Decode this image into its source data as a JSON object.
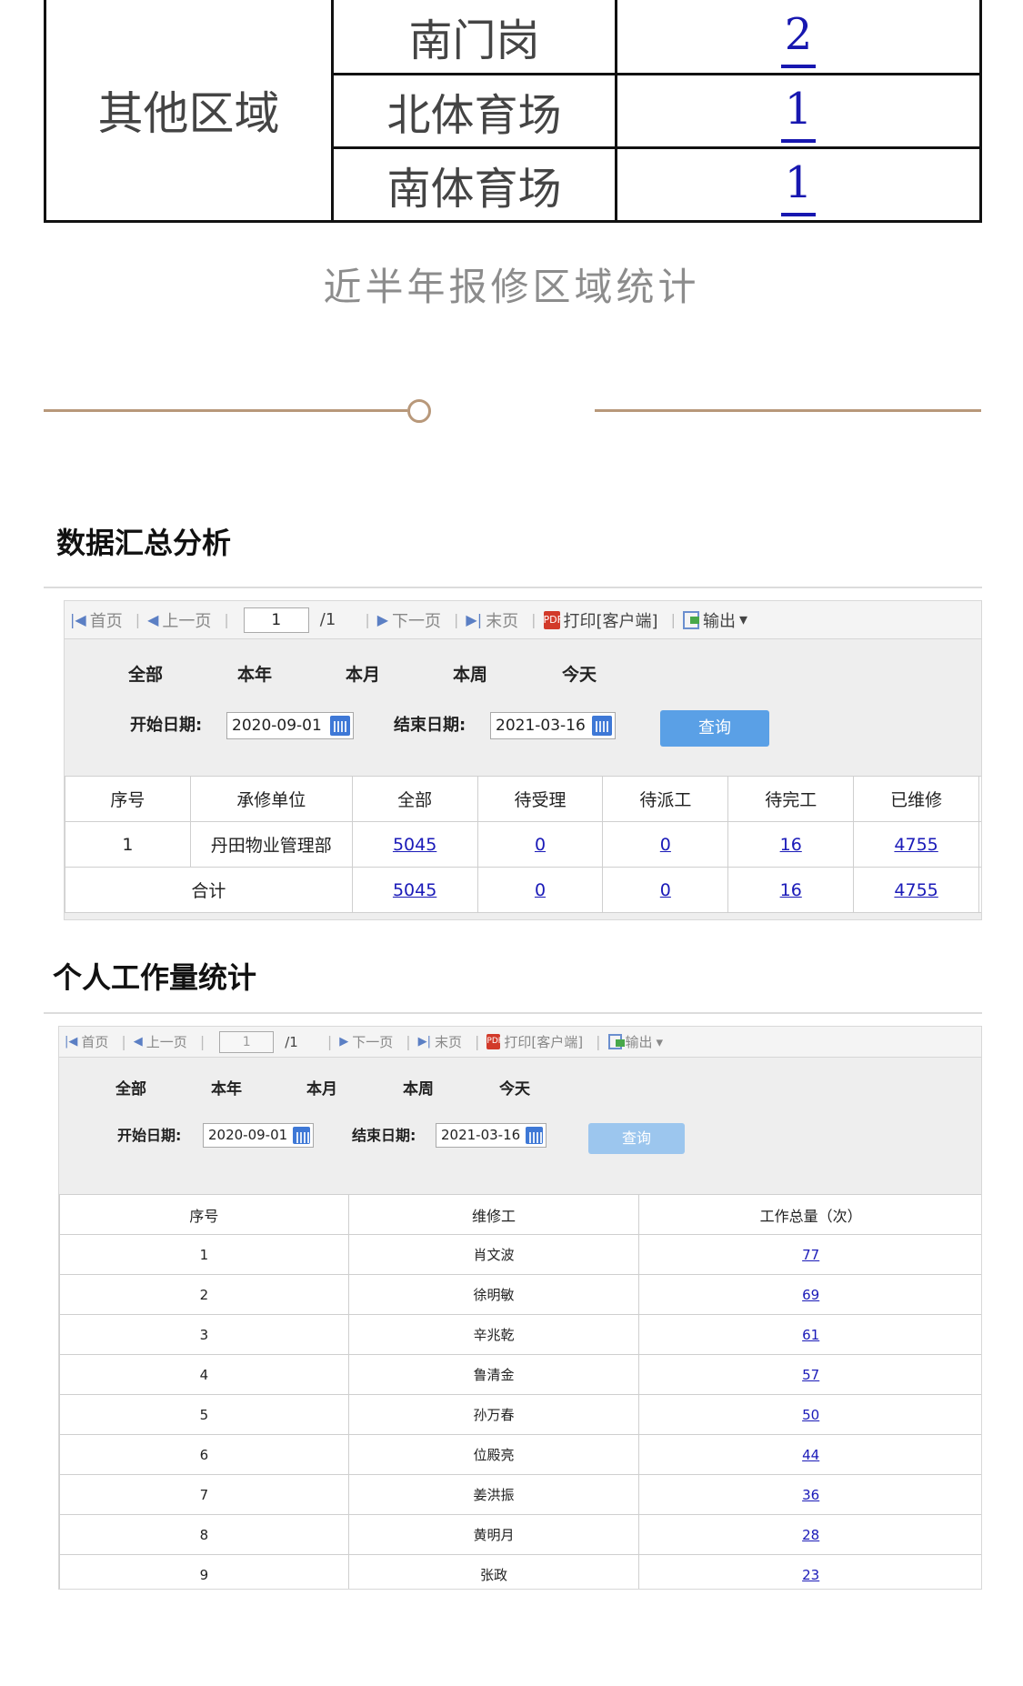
{
  "region_table": {
    "area_label": "其他区域",
    "rows": [
      {
        "place": "南门岗",
        "count": "2"
      },
      {
        "place": "北体育场",
        "count": "1"
      },
      {
        "place": "南体育场",
        "count": "1"
      }
    ]
  },
  "caption": "近半年报修区域统计",
  "summary_section": {
    "title": "数据汇总分析",
    "toolbar": {
      "first": "首页",
      "prev": "上一页",
      "page": "1",
      "total": "/1",
      "next": "下一页",
      "last": "末页",
      "print": "打印[客户端]",
      "export": "输出"
    },
    "ranges": [
      "全部",
      "本年",
      "本月",
      "本周",
      "今天"
    ],
    "start_label": "开始日期:",
    "start_date": "2020-09-01",
    "end_label": "结束日期:",
    "end_date": "2021-03-16",
    "query_label": "查询",
    "columns": [
      "序号",
      "承修单位",
      "全部",
      "待受理",
      "待派工",
      "待完工",
      "已维修"
    ],
    "rows": [
      {
        "seq": "1",
        "unit": "丹田物业管理部",
        "all": "5045",
        "pending_accept": "0",
        "pending_dispatch": "0",
        "pending_complete": "16",
        "repaired": "4755"
      }
    ],
    "total_row": {
      "label": "合计",
      "all": "5045",
      "pending_accept": "0",
      "pending_dispatch": "0",
      "pending_complete": "16",
      "repaired": "4755"
    }
  },
  "workload_section": {
    "title": "个人工作量统计",
    "toolbar": {
      "first": "首页",
      "prev": "上一页",
      "page": "1",
      "total": "/1",
      "next": "下一页",
      "last": "末页",
      "print": "打印[客户端]",
      "export": "输出"
    },
    "ranges": [
      "全部",
      "本年",
      "本月",
      "本周",
      "今天"
    ],
    "start_label": "开始日期:",
    "start_date": "2020-09-01",
    "end_label": "结束日期:",
    "end_date": "2021-03-16",
    "query_label": "查询",
    "columns": [
      "序号",
      "维修工",
      "工作总量（次）"
    ],
    "rows": [
      {
        "seq": "1",
        "name": "肖文波",
        "count": "77"
      },
      {
        "seq": "2",
        "name": "徐明敏",
        "count": "69"
      },
      {
        "seq": "3",
        "name": "辛兆乾",
        "count": "61"
      },
      {
        "seq": "4",
        "name": "鲁清金",
        "count": "57"
      },
      {
        "seq": "5",
        "name": "孙万春",
        "count": "50"
      },
      {
        "seq": "6",
        "name": "位殿亮",
        "count": "44"
      },
      {
        "seq": "7",
        "name": "姜洪振",
        "count": "36"
      },
      {
        "seq": "8",
        "name": "黄明月",
        "count": "28"
      },
      {
        "seq": "9",
        "name": "张政",
        "count": "23"
      }
    ]
  },
  "colors": {
    "link": "#1a1ab8",
    "divider": "#b8987a",
    "query_button": "#5aa0e6"
  }
}
